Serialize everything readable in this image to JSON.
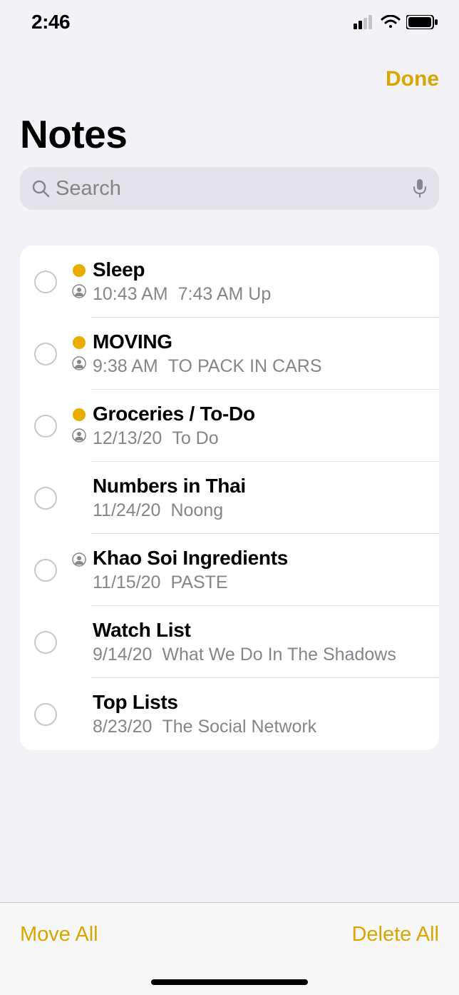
{
  "status_bar": {
    "time": "2:46"
  },
  "nav": {
    "done_label": "Done"
  },
  "page": {
    "title": "Notes"
  },
  "search": {
    "placeholder": "Search"
  },
  "notes": [
    {
      "title": "Sleep",
      "timestamp": "10:43 AM",
      "preview": "7:43 AM Up",
      "unread": true,
      "shared": true
    },
    {
      "title": "MOVING",
      "timestamp": "9:38 AM",
      "preview": "TO PACK IN CARS",
      "unread": true,
      "shared": true
    },
    {
      "title": "Groceries / To-Do",
      "timestamp": "12/13/20",
      "preview": "To Do",
      "unread": true,
      "shared": true
    },
    {
      "title": "Numbers in Thai",
      "timestamp": "11/24/20",
      "preview": "Noong",
      "unread": false,
      "shared": false
    },
    {
      "title": "Khao Soi Ingredients",
      "timestamp": "11/15/20",
      "preview": "PASTE",
      "unread": false,
      "shared": true
    },
    {
      "title": "Watch List",
      "timestamp": "9/14/20",
      "preview": "What We Do In The Shadows",
      "unread": false,
      "shared": false
    },
    {
      "title": "Top Lists",
      "timestamp": "8/23/20",
      "preview": "The Social Network",
      "unread": false,
      "shared": false
    }
  ],
  "toolbar": {
    "move_all_label": "Move All",
    "delete_all_label": "Delete All"
  }
}
